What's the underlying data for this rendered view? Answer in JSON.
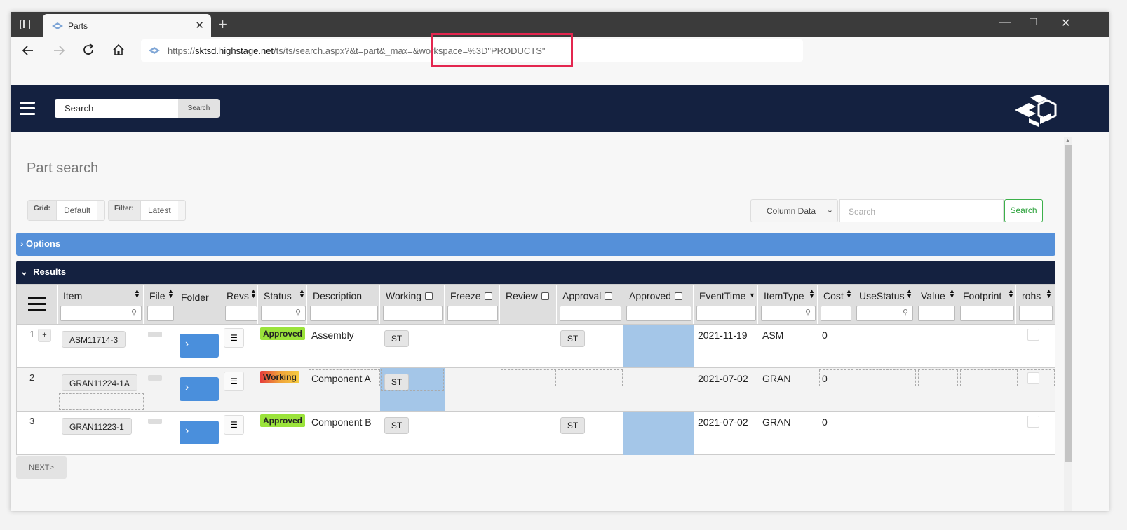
{
  "browser": {
    "tab_title": "Parts",
    "new_tab": "+",
    "close_tab": "✕",
    "url_scheme": "https://",
    "url_host": "sktsd.highstage.net",
    "url_path": "/ts/ts/search.aspx?&t=part&_max=",
    "url_query": "&workspace=%3D\"PRODUCTS\"",
    "win_min": "—",
    "win_max": "☐",
    "win_close": "✕"
  },
  "header": {
    "search_placeholder": "Search",
    "search_button": "Search"
  },
  "page": {
    "title": "Part search",
    "grid_label": "Grid:",
    "grid_value": "Default",
    "filter_label": "Filter:",
    "filter_value": "Latest",
    "column_select": "Column Data",
    "search_placeholder": "Search",
    "search_button": "Search",
    "options_label": "Options",
    "results_label": "Results",
    "next_button": "NEXT>"
  },
  "columns": {
    "item": "Item",
    "file": "File",
    "folder": "Folder",
    "revs": "Revs",
    "status": "Status",
    "description": "Description",
    "working": "Working",
    "freeze": "Freeze",
    "review": "Review",
    "approval": "Approval",
    "approved": "Approved",
    "eventtime": "EventTime",
    "itemtype": "ItemType",
    "cost": "Cost",
    "usestatus": "UseStatus",
    "value": "Value",
    "footprint": "Footprint",
    "rohs": "rohs"
  },
  "rows": [
    {
      "num": "1",
      "expand": "+",
      "item": "ASM11714-3",
      "status": "Approved",
      "description": "Assembly",
      "working": "ST",
      "approval": "ST",
      "eventtime": "2021-11-19",
      "itemtype": "ASM",
      "cost": "0"
    },
    {
      "num": "2",
      "item": "GRAN11224-1A",
      "status": "Working",
      "description": "Component A",
      "working": "ST",
      "eventtime": "2021-07-02",
      "itemtype": "GRAN",
      "cost": "0"
    },
    {
      "num": "3",
      "item": "GRAN11223-1",
      "status": "Approved",
      "description": "Component B",
      "working": "ST",
      "approval": "ST",
      "eventtime": "2021-07-02",
      "itemtype": "GRAN",
      "cost": "0"
    }
  ],
  "colors": {
    "header_bg": "#142140",
    "options_bar": "#5590d9",
    "approved": "#9be33b",
    "highlight_box": "#e3264f",
    "selected_cell": "#a4c6e8"
  }
}
